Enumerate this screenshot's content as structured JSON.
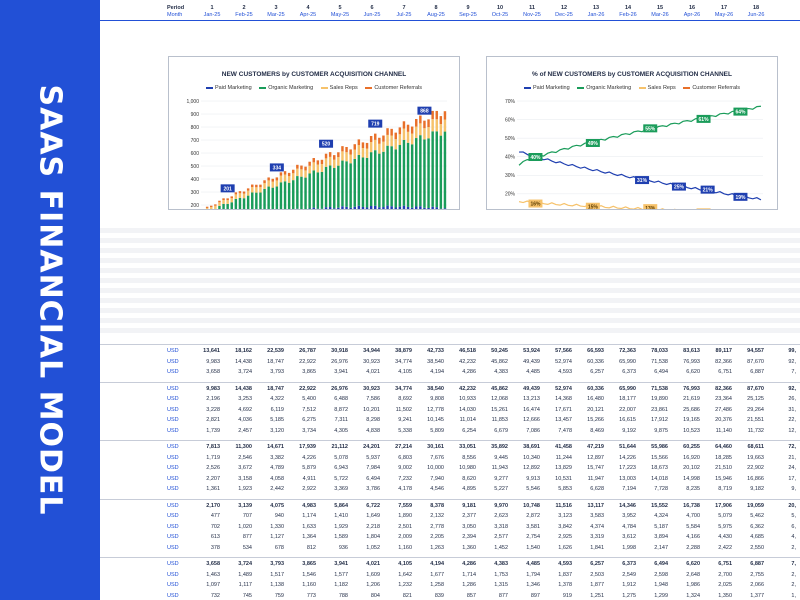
{
  "sidebar": {
    "title": "SAAS FINANCIAL MODEL"
  },
  "header": {
    "period_label": "Period",
    "month_label": "Month",
    "periods": [
      "1",
      "2",
      "3",
      "4",
      "5",
      "6",
      "7",
      "8",
      "9",
      "10",
      "11",
      "12",
      "13",
      "14",
      "15",
      "16",
      "17",
      "18"
    ],
    "months": [
      "Jan-25",
      "Feb-25",
      "Mar-25",
      "Apr-25",
      "May-25",
      "Jun-25",
      "Jul-25",
      "Aug-25",
      "Sep-25",
      "Oct-25",
      "Nov-25",
      "Dec-25",
      "Jan-26",
      "Feb-26",
      "Mar-26",
      "Apr-26",
      "May-26",
      "Jun-26"
    ]
  },
  "colors": {
    "brand": "#2250d6",
    "paid_marketing": "#1f3fb0",
    "organic_marketing": "#1a9c5a",
    "sales_reps": "#f6c26b",
    "customer_referrals": "#e8702a"
  },
  "chart_data": [
    {
      "type": "bar",
      "title": "NEW CUSTOMERS by CUSTOMER ACQUISITION CHANNEL",
      "stacked": true,
      "legend": [
        "Paid Marketing",
        "Organic Marketing",
        "Sales Reps",
        "Customer Referrals"
      ],
      "legend_placement": "top",
      "ylim": [
        0,
        1000
      ],
      "y_ticks": [
        "-",
        "100",
        "200",
        "300",
        "400",
        "500",
        "600",
        "700",
        "800",
        "900",
        "1,000"
      ],
      "x_ticks": [
        "Jan-25",
        "Apr-25",
        "Jul-25",
        "Oct-25",
        "Jan-26",
        "Apr-26",
        "Jul-26",
        "Oct-26",
        "Jan-27",
        "Apr-27",
        "Jul-27",
        "Oct-27",
        "Jan-28",
        "Apr-28",
        "Jul-28",
        "Oct-28",
        "Jan-29",
        "Apr-29",
        "Jul-29",
        "Oct-29"
      ],
      "n_bars": 60,
      "total_start": 160,
      "total_end": 930,
      "share_start": {
        "paid": 0.43,
        "organic": 0.4,
        "sales": 0.12,
        "referral": 0.05
      },
      "share_end": {
        "paid": 0.19,
        "organic": 0.64,
        "sales": 0.1,
        "referral": 0.07
      },
      "data_labels": [
        {
          "index": 6,
          "value": "201"
        },
        {
          "index": 18,
          "value": "334"
        },
        {
          "index": 30,
          "value": "520"
        },
        {
          "index": 42,
          "value": "719"
        },
        {
          "index": 54,
          "value": "868"
        }
      ]
    },
    {
      "type": "line",
      "title": "% of NEW CUSTOMERS by CUSTOMER ACQUISITION CHANNEL",
      "legend": [
        "Paid Marketing",
        "Organic Marketing",
        "Sales Reps",
        "Customer Referrals"
      ],
      "legend_placement": "top",
      "ylim": [
        0,
        70
      ],
      "y_ticks": [
        "0%",
        "10%",
        "20%",
        "30%",
        "40%",
        "50%",
        "60%",
        "70%"
      ],
      "x_ticks": [
        "Jan-25",
        "Apr-25",
        "Jul-25",
        "Oct-25",
        "Jan-26",
        "Apr-26",
        "Jul-26",
        "Oct-26",
        "Jan-27",
        "Apr-27",
        "Jul-27",
        "Oct-27",
        "Jan-28",
        "Apr-28",
        "Jul-28",
        "Oct-28",
        "Jan-29",
        "Apr-29",
        "Jul-29",
        "Oct-29"
      ],
      "n_points": 60,
      "series": [
        {
          "name": "Paid Marketing",
          "start": 43,
          "end": 17
        },
        {
          "name": "Organic Marketing",
          "start": 36,
          "end": 67
        },
        {
          "name": "Sales Reps",
          "start": 16,
          "end": 9
        },
        {
          "name": "Customer Referrals",
          "start": 5,
          "end": 7
        }
      ],
      "data_labels": [
        {
          "series": 0,
          "index": 30,
          "value": "31%"
        },
        {
          "series": 0,
          "index": 39,
          "value": "25%"
        },
        {
          "series": 0,
          "index": 46,
          "value": "21%"
        },
        {
          "series": 0,
          "index": 54,
          "value": "19%"
        },
        {
          "series": 1,
          "index": 4,
          "value": "40%"
        },
        {
          "series": 1,
          "index": 18,
          "value": "49%"
        },
        {
          "series": 1,
          "index": 32,
          "value": "55%"
        },
        {
          "series": 1,
          "index": 45,
          "value": "61%"
        },
        {
          "series": 1,
          "index": 54,
          "value": "64%"
        },
        {
          "series": 2,
          "index": 4,
          "value": "16%"
        },
        {
          "series": 2,
          "index": 18,
          "value": "15%"
        },
        {
          "series": 2,
          "index": 32,
          "value": "13%"
        },
        {
          "series": 2,
          "index": 45,
          "value": "11%"
        },
        {
          "series": 2,
          "index": 54,
          "value": "10%"
        },
        {
          "series": 3,
          "index": 4,
          "value": "5%"
        },
        {
          "series": 3,
          "index": 18,
          "value": "6%"
        },
        {
          "series": 3,
          "index": 32,
          "value": "6%"
        },
        {
          "series": 3,
          "index": 45,
          "value": "6%"
        },
        {
          "series": 3,
          "index": 54,
          "value": "7%"
        }
      ]
    }
  ],
  "table": {
    "rows": [
      {
        "label": "USD",
        "bold": true,
        "values": [
          "13,641",
          "18,162",
          "22,539",
          "26,787",
          "30,918",
          "34,944",
          "38,879",
          "42,733",
          "46,518",
          "50,245",
          "53,924",
          "57,566",
          "66,593",
          "72,363",
          "78,033",
          "83,613",
          "89,117",
          "94,557",
          "99,"
        ]
      },
      {
        "label": "USD",
        "values": [
          "9,983",
          "14,438",
          "18,747",
          "22,922",
          "26,976",
          "30,923",
          "34,774",
          "38,540",
          "42,232",
          "45,862",
          "49,439",
          "52,974",
          "60,336",
          "65,990",
          "71,538",
          "76,993",
          "82,366",
          "87,670",
          "92,"
        ]
      },
      {
        "label": "USD",
        "values": [
          "3,658",
          "3,724",
          "3,793",
          "3,865",
          "3,941",
          "4,021",
          "4,105",
          "4,194",
          "4,286",
          "4,383",
          "4,485",
          "4,593",
          "6,257",
          "6,373",
          "6,494",
          "6,620",
          "6,751",
          "6,887",
          "7,"
        ]
      },
      {
        "label": "USD",
        "bold": true,
        "values": [
          "9,983",
          "14,438",
          "18,747",
          "22,922",
          "26,976",
          "30,923",
          "34,774",
          "38,540",
          "42,232",
          "45,862",
          "49,439",
          "52,974",
          "60,336",
          "65,990",
          "71,538",
          "76,993",
          "82,366",
          "87,670",
          "92,"
        ]
      },
      {
        "label": "USD",
        "values": [
          "2,196",
          "3,253",
          "4,322",
          "5,400",
          "6,488",
          "7,586",
          "8,692",
          "9,808",
          "10,933",
          "12,068",
          "13,213",
          "14,368",
          "16,480",
          "18,177",
          "19,890",
          "21,619",
          "23,364",
          "25,125",
          "26,"
        ]
      },
      {
        "label": "USD",
        "values": [
          "3,228",
          "4,692",
          "6,119",
          "7,512",
          "8,872",
          "10,201",
          "11,502",
          "12,778",
          "14,030",
          "15,261",
          "16,474",
          "17,671",
          "20,121",
          "22,007",
          "23,861",
          "25,686",
          "27,486",
          "29,264",
          "31,"
        ]
      },
      {
        "label": "USD",
        "values": [
          "2,821",
          "4,036",
          "5,185",
          "6,275",
          "7,311",
          "8,298",
          "9,241",
          "10,145",
          "11,014",
          "11,853",
          "12,666",
          "13,457",
          "15,266",
          "16,615",
          "17,912",
          "19,165",
          "20,376",
          "21,551",
          "22,"
        ]
      },
      {
        "label": "USD",
        "values": [
          "1,739",
          "2,457",
          "3,120",
          "3,734",
          "4,305",
          "4,838",
          "5,338",
          "5,809",
          "6,254",
          "6,679",
          "7,086",
          "7,478",
          "8,469",
          "9,192",
          "9,875",
          "10,523",
          "11,140",
          "11,732",
          "12,"
        ]
      },
      {
        "label": "USD",
        "bold": true,
        "values": [
          "7,813",
          "11,300",
          "14,671",
          "17,939",
          "21,112",
          "24,201",
          "27,214",
          "30,161",
          "33,051",
          "35,892",
          "38,691",
          "41,458",
          "47,219",
          "51,644",
          "55,986",
          "60,255",
          "64,460",
          "68,611",
          "72,"
        ]
      },
      {
        "label": "USD",
        "values": [
          "1,719",
          "2,546",
          "3,382",
          "4,226",
          "5,078",
          "5,937",
          "6,803",
          "7,676",
          "8,556",
          "9,445",
          "10,340",
          "11,244",
          "12,897",
          "14,226",
          "15,566",
          "16,920",
          "18,285",
          "19,663",
          "21,"
        ]
      },
      {
        "label": "USD",
        "values": [
          "2,526",
          "3,672",
          "4,789",
          "5,879",
          "6,943",
          "7,984",
          "9,002",
          "10,000",
          "10,980",
          "11,943",
          "12,892",
          "13,829",
          "15,747",
          "17,223",
          "18,673",
          "20,102",
          "21,510",
          "22,902",
          "24,"
        ]
      },
      {
        "label": "USD",
        "values": [
          "2,207",
          "3,158",
          "4,058",
          "4,911",
          "5,722",
          "6,494",
          "7,232",
          "7,940",
          "8,620",
          "9,277",
          "9,913",
          "10,531",
          "11,947",
          "13,003",
          "14,018",
          "14,998",
          "15,946",
          "16,866",
          "17,"
        ]
      },
      {
        "label": "USD",
        "values": [
          "1,361",
          "1,923",
          "2,442",
          "2,922",
          "3,369",
          "3,786",
          "4,178",
          "4,546",
          "4,895",
          "5,227",
          "5,546",
          "5,853",
          "6,628",
          "7,194",
          "7,728",
          "8,235",
          "8,719",
          "9,182",
          "9,"
        ]
      },
      {
        "label": "USD",
        "bold": true,
        "values": [
          "2,170",
          "3,139",
          "4,075",
          "4,983",
          "5,864",
          "6,722",
          "7,559",
          "8,378",
          "9,181",
          "9,970",
          "10,748",
          "11,516",
          "13,117",
          "14,346",
          "15,552",
          "16,738",
          "17,906",
          "19,059",
          "20,"
        ]
      },
      {
        "label": "USD",
        "values": [
          "477",
          "707",
          "940",
          "1,174",
          "1,410",
          "1,649",
          "1,890",
          "2,132",
          "2,377",
          "2,623",
          "2,872",
          "3,123",
          "3,583",
          "3,952",
          "4,324",
          "4,700",
          "5,079",
          "5,462",
          "5,"
        ]
      },
      {
        "label": "USD",
        "values": [
          "702",
          "1,020",
          "1,330",
          "1,633",
          "1,929",
          "2,218",
          "2,501",
          "2,778",
          "3,050",
          "3,318",
          "3,581",
          "3,842",
          "4,374",
          "4,784",
          "5,187",
          "5,584",
          "5,975",
          "6,362",
          "6,"
        ]
      },
      {
        "label": "USD",
        "values": [
          "613",
          "877",
          "1,127",
          "1,364",
          "1,589",
          "1,804",
          "2,009",
          "2,205",
          "2,394",
          "2,577",
          "2,754",
          "2,925",
          "3,319",
          "3,612",
          "3,894",
          "4,166",
          "4,430",
          "4,685",
          "4,"
        ]
      },
      {
        "label": "USD",
        "values": [
          "378",
          "534",
          "678",
          "812",
          "936",
          "1,052",
          "1,160",
          "1,263",
          "1,360",
          "1,452",
          "1,540",
          "1,626",
          "1,841",
          "1,998",
          "2,147",
          "2,288",
          "2,422",
          "2,550",
          "2,"
        ]
      },
      {
        "label": "USD",
        "bold": true,
        "values": [
          "3,658",
          "3,724",
          "3,793",
          "3,865",
          "3,941",
          "4,021",
          "4,105",
          "4,194",
          "4,286",
          "4,383",
          "4,485",
          "4,593",
          "6,257",
          "6,373",
          "6,494",
          "6,620",
          "6,751",
          "6,887",
          "7,"
        ]
      },
      {
        "label": "USD",
        "values": [
          "1,463",
          "1,489",
          "1,517",
          "1,546",
          "1,577",
          "1,609",
          "1,642",
          "1,677",
          "1,714",
          "1,753",
          "1,794",
          "1,837",
          "2,503",
          "2,549",
          "2,598",
          "2,648",
          "2,700",
          "2,755",
          "2,"
        ]
      },
      {
        "label": "USD",
        "values": [
          "1,097",
          "1,117",
          "1,138",
          "1,160",
          "1,182",
          "1,206",
          "1,232",
          "1,258",
          "1,286",
          "1,315",
          "1,346",
          "1,378",
          "1,877",
          "1,912",
          "1,948",
          "1,986",
          "2,025",
          "2,066",
          "2,"
        ]
      },
      {
        "label": "USD",
        "values": [
          "732",
          "745",
          "759",
          "773",
          "788",
          "804",
          "821",
          "839",
          "857",
          "877",
          "897",
          "919",
          "1,251",
          "1,275",
          "1,299",
          "1,324",
          "1,350",
          "1,377",
          "1,"
        ]
      }
    ]
  }
}
